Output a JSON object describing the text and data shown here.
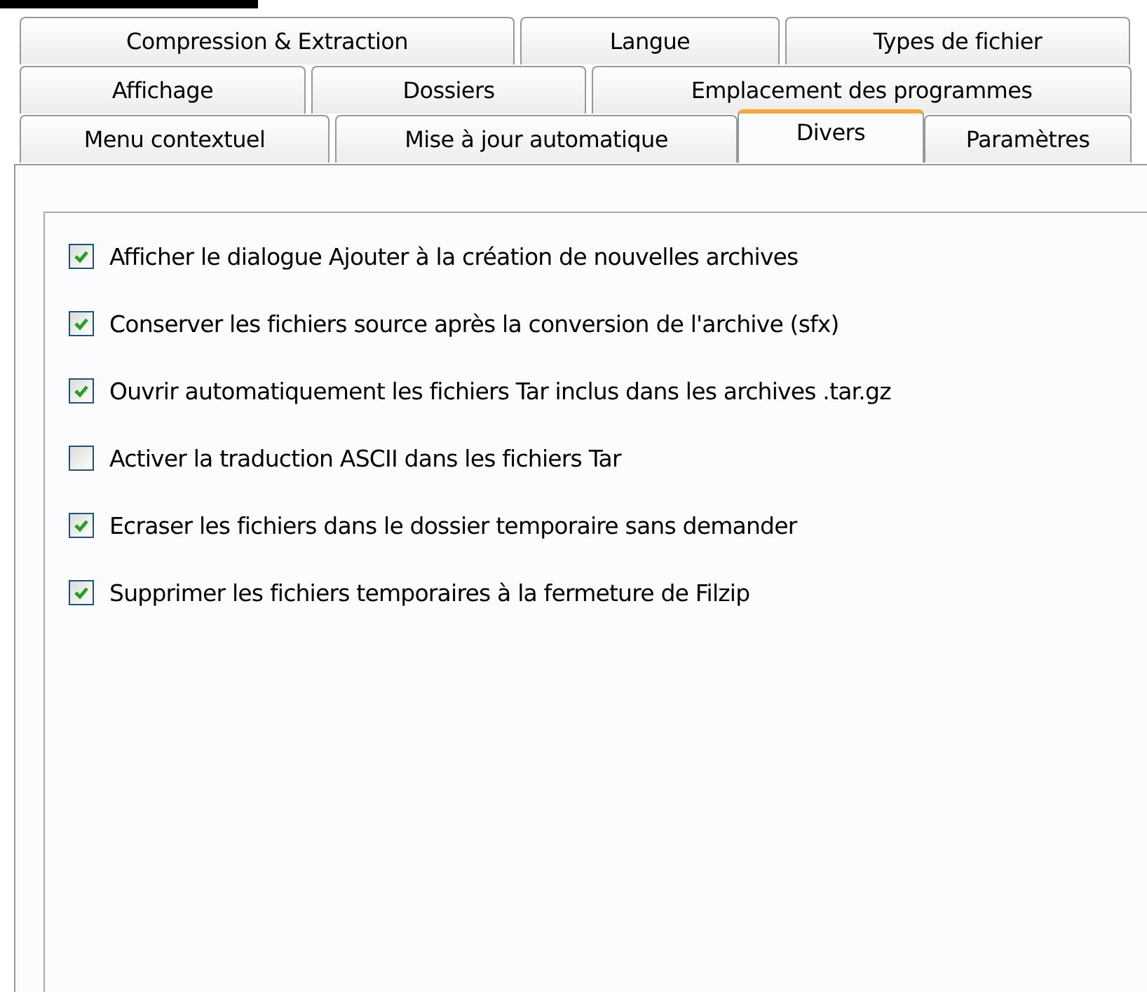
{
  "tab_rows": [
    [
      {
        "label": "Compression & Extraction",
        "selected": false
      },
      {
        "label": "Langue",
        "selected": false
      },
      {
        "label": "Types de fichier",
        "selected": false
      }
    ],
    [
      {
        "label": "Affichage",
        "selected": false
      },
      {
        "label": "Dossiers",
        "selected": false
      },
      {
        "label": "Emplacement des programmes",
        "selected": false
      }
    ],
    [
      {
        "label": "Menu contextuel",
        "selected": false
      },
      {
        "label": "Mise à jour automatique",
        "selected": false
      },
      {
        "label": "Divers",
        "selected": true
      },
      {
        "label": "Paramètres",
        "selected": false
      }
    ]
  ],
  "options": [
    {
      "label": "Afficher le dialogue Ajouter à la création de nouvelles archives",
      "checked": true
    },
    {
      "label": "Conserver les fichiers source après la conversion de l'archive (sfx)",
      "checked": true
    },
    {
      "label": "Ouvrir automatiquement les fichiers Tar inclus dans les archives .tar.gz",
      "checked": true
    },
    {
      "label": "Activer la traduction ASCII dans les fichiers Tar",
      "checked": false
    },
    {
      "label": "Ecraser les fichiers dans le dossier temporaire sans demander",
      "checked": true
    },
    {
      "label": "Supprimer les fichiers temporaires à la fermeture de Filzip",
      "checked": true
    }
  ]
}
